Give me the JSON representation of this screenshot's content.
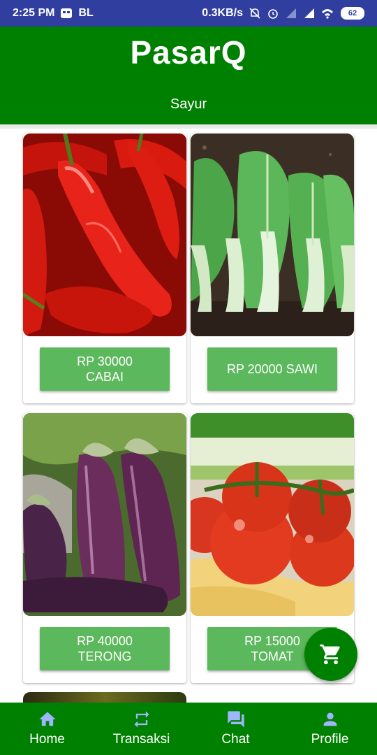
{
  "status_bar": {
    "time": "2:25 PM",
    "carrier_label": "BL",
    "network_speed": "0.3KB/s",
    "battery": "62"
  },
  "header": {
    "title": "PasarQ",
    "subtitle": "Sayur"
  },
  "products": [
    {
      "button_label": "RP 30000\nCABAI",
      "image": "chili-image"
    },
    {
      "button_label": "RP 20000 SAWI",
      "image": "bok-choy-image"
    },
    {
      "button_label": "RP 40000\nTERONG",
      "image": "eggplant-image"
    },
    {
      "button_label": "RP 15000\nTOMAT",
      "image": "tomato-image"
    }
  ],
  "fab": {
    "icon": "cart-icon"
  },
  "bottom_nav": [
    {
      "label": "Home",
      "icon": "home-icon"
    },
    {
      "label": "Transaksi",
      "icon": "repeat-icon"
    },
    {
      "label": "Chat",
      "icon": "chat-icon"
    },
    {
      "label": "Profile",
      "icon": "person-icon"
    }
  ],
  "colors": {
    "status_bar": "#303f9f",
    "primary": "#008000",
    "button": "#5cb85c"
  }
}
